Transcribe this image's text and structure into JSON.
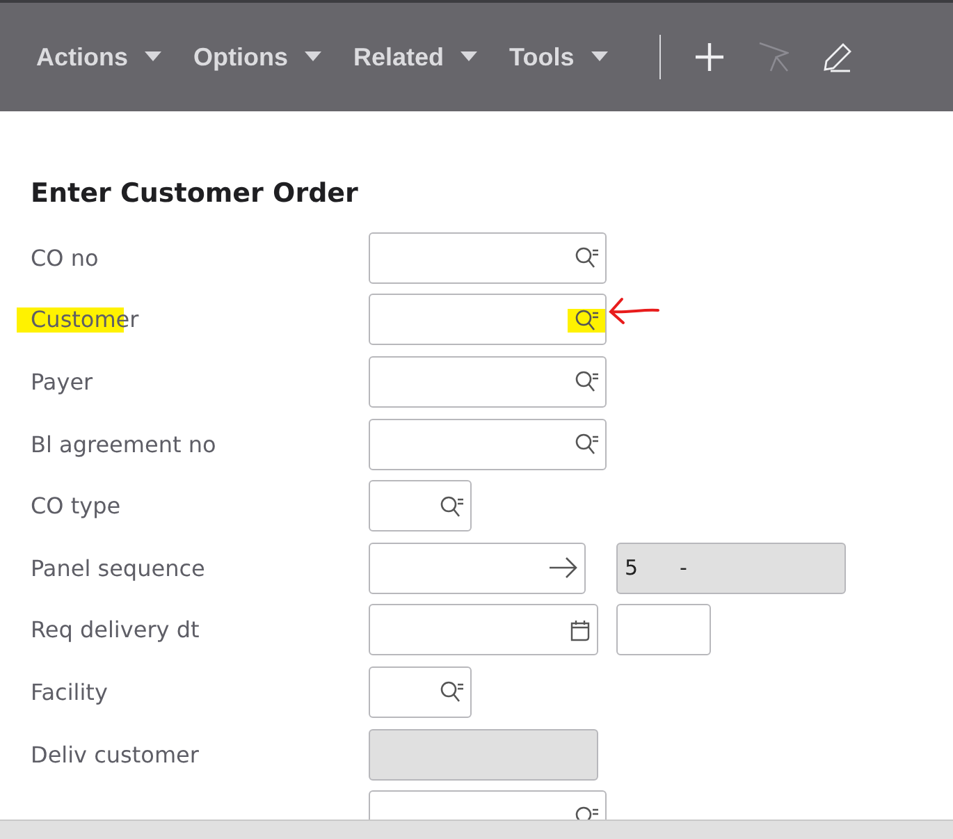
{
  "toolbar": {
    "menus": [
      {
        "label": "Actions"
      },
      {
        "label": "Options"
      },
      {
        "label": "Related"
      },
      {
        "label": "Tools"
      }
    ],
    "tools": [
      {
        "kind": "add",
        "disabled": false
      },
      {
        "kind": "select",
        "disabled": true
      },
      {
        "kind": "edit",
        "disabled": false
      }
    ]
  },
  "form": {
    "title": "Enter Customer Order",
    "rows": [
      {
        "label": "CO no",
        "kind": "lookup"
      },
      {
        "label": "Customer",
        "kind": "lookup",
        "annotated": true
      },
      {
        "label": "Payer",
        "kind": "lookup"
      },
      {
        "label": "Bl agreement no",
        "kind": "lookup"
      },
      {
        "label": "CO type",
        "kind": "lookup-short"
      },
      {
        "label": "Panel sequence",
        "kind": "sequence",
        "extra": {
          "kind": "display",
          "value": "5",
          "suffix": "-"
        }
      },
      {
        "label": "Req delivery dt",
        "kind": "date",
        "extra": {
          "kind": "input"
        }
      },
      {
        "label": "Facility",
        "kind": "lookup-short"
      },
      {
        "label": "Deliv customer",
        "kind": "display"
      },
      {
        "kind": "lookup"
      }
    ]
  }
}
